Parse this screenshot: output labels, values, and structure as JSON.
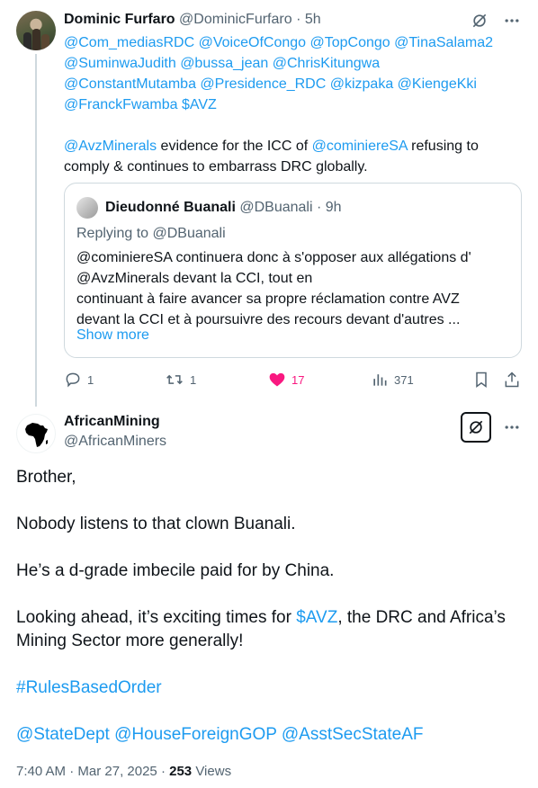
{
  "parent_tweet": {
    "author_name": "Dominic Furfaro",
    "author_handle": "@DominicFurfaro",
    "separator": "·",
    "time": "5h",
    "mentions_line1": "@Com_mediasRDC @VoiceOfCongo @TopCongo @TinaSalama2",
    "mentions_line2": "@SuminwaJudith @bussa_jean @ChrisKitungwa",
    "mentions_line3": "@ConstantMutamba @Presidence_RDC @kizpaka @KiengeKki",
    "mentions_line4a": "@FranckFwamba",
    "mentions_line4b": "$AVZ",
    "body_mention1": "@AvzMinerals",
    "body_text1": " evidence for the ICC of ",
    "body_mention2": "@cominiereSA",
    "body_text2": " refusing to comply & continues to embarrass DRC globally.",
    "quote": {
      "author_name": "Dieudonné Buanali",
      "author_handle": "@DBuanali",
      "separator": "·",
      "time": "9h",
      "replying_to": "Replying to @DBuanali",
      "text_line1": "@cominiereSA continuera donc à s'opposer aux allégations d'",
      "text_line2": "@AvzMinerals devant la CCI, tout en",
      "text_line3": "continuant à faire avancer sa propre réclamation contre AVZ",
      "text_line4": "devant la CCI et à poursuivre des recours devant d'autres ...",
      "show_more": "Show more"
    },
    "actions": {
      "replies": "1",
      "reposts": "1",
      "likes": "17",
      "views": "371"
    }
  },
  "main_tweet": {
    "author_name": "AfricanMining",
    "author_handle": "@AfricanMiners",
    "paragraphs": {
      "p1": "Brother,",
      "p2": "Nobody listens to that clown Buanali.",
      "p3": "He’s a d-grade imbecile paid for by China.",
      "p4_start": "Looking ahead, it’s exciting times for ",
      "p4_cashtag": "$AVZ",
      "p4_end": ", the DRC and Africa’s Mining Sector more generally!",
      "p5_hashtag": "#RulesBasedOrder",
      "p6_mention1": "@StateDept",
      "p6_mention2": "@HouseForeignGOP",
      "p6_mention3": "@AsstSecStateAF"
    },
    "meta": {
      "time": "7:40 AM",
      "separator": "·",
      "date": "Mar 27, 2025",
      "separator2": "·",
      "views_count": "253",
      "views_label": "Views"
    }
  },
  "colors": {
    "link": "#1d9bf0",
    "muted": "#536471",
    "like": "#f91880",
    "text": "#0f1419",
    "border": "#cfd9de"
  },
  "icons": [
    "grok-icon",
    "more-icon",
    "reply-icon",
    "repost-icon",
    "like-icon",
    "views-icon",
    "bookmark-icon",
    "share-icon",
    "africa-map-icon"
  ]
}
